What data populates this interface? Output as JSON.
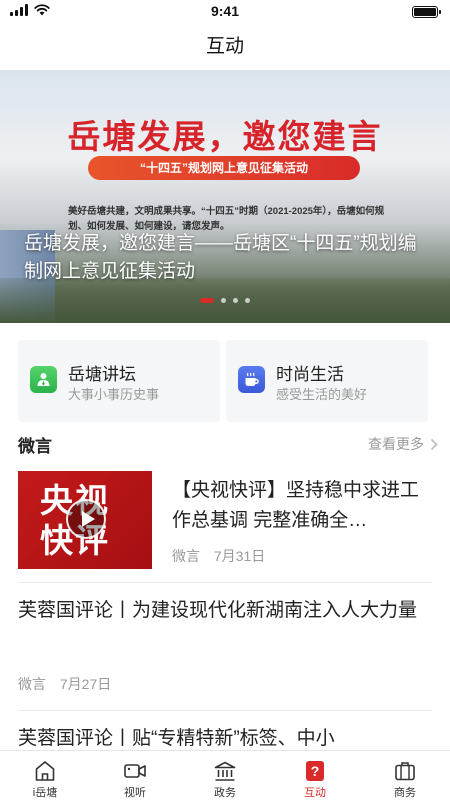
{
  "status_bar": {
    "time": "9:41"
  },
  "nav": {
    "title": "互动"
  },
  "banner": {
    "headline": "岳塘发展，邀您建言",
    "pill": "“十四五”规划网上意见征集活动",
    "small_text": "美好岳塘共建，文明成果共享。“十四五”时期（2021-2025年），岳塘如何规划、如何发展、如何建设，请您发声。",
    "caption": "岳塘发展，邀您建言——岳塘区“十四五”规划编制网上意见征集活动",
    "page_count": 4,
    "active_index": 0
  },
  "categories": [
    {
      "title": "岳塘讲坛",
      "subtitle": "大事小事历史事",
      "icon": "lecture-person-icon",
      "color": "#2bb34a"
    },
    {
      "title": "时尚生活",
      "subtitle": "感受生活的美好",
      "icon": "coffee-cup-icon",
      "color": "#3b59d9"
    }
  ],
  "section": {
    "title": "微言",
    "more": "查看更多"
  },
  "news": [
    {
      "title": "【央视快评】坚持稳中求进工作总基调 完整准确全…",
      "source": "微言",
      "date": "7月31日",
      "thumb_text": "央视快评"
    },
    {
      "title": "芙蓉国评论丨为建设现代化新湖南注入人大力量",
      "source": "微言",
      "date": "7月27日"
    },
    {
      "title": "芙蓉国评论丨贴“专精特新”标签、中小"
    }
  ],
  "tabs": [
    {
      "label": "i岳塘",
      "icon": "home-icon",
      "active": false
    },
    {
      "label": "视听",
      "icon": "video-camera-icon",
      "active": false
    },
    {
      "label": "政务",
      "icon": "government-building-icon",
      "active": false
    },
    {
      "label": "互动",
      "icon": "question-bubble-icon",
      "active": true
    },
    {
      "label": "商务",
      "icon": "briefcase-icon",
      "active": false
    }
  ],
  "colors": {
    "accent": "#d92b2a",
    "muted": "#999999"
  }
}
